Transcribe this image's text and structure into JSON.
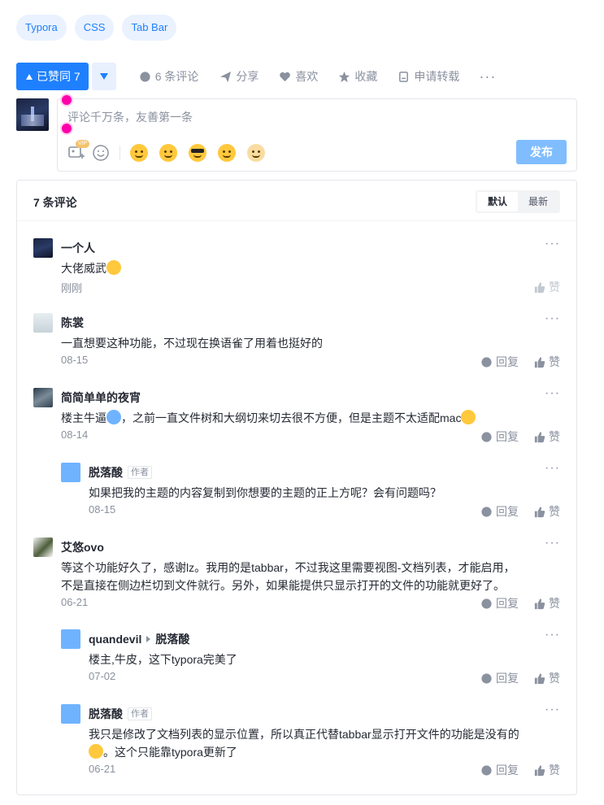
{
  "tags": [
    "Typora",
    "CSS",
    "Tab Bar"
  ],
  "actions": {
    "liked_label": "已赞同 7",
    "comment_label": "6 条评论",
    "share_label": "分享",
    "like_label": "喜欢",
    "favorite_label": "收藏",
    "repost_label": "申请转载",
    "more_label": "···"
  },
  "editor": {
    "placeholder": "评论千万条，友善第一条",
    "vip_badge": "VIP",
    "publish_label": "发布"
  },
  "comments_panel": {
    "title": "7 条评论",
    "sort_default": "默认",
    "sort_latest": "最新"
  },
  "comments": [
    {
      "name": "一个人",
      "text": "大佬威武",
      "time": "刚刚",
      "reply": "",
      "like": "赞"
    },
    {
      "name": "陈裳",
      "text": "一直想要这种功能，不过现在换语雀了用着也挺好的",
      "time": "08-15",
      "reply": "回复",
      "like": "赞"
    },
    {
      "name": "简简单单的夜宵",
      "text_a": "楼主牛逼",
      "text_b": "，之前一直文件树和大纲切来切去很不方便，但是主题不太适配mac",
      "time": "08-14",
      "reply": "回复",
      "like": "赞"
    },
    {
      "name": "脱落酸",
      "author_tag": "作者",
      "text": "如果把我的主题的内容复制到你想要的主题的正上方呢？会有问题吗？",
      "time": "08-15",
      "reply": "回复",
      "like": "赞"
    },
    {
      "name": "艾悠ovo",
      "text_l1": "等这个功能好久了，感谢lz。我用的是tabbar，不过我这里需要视图-文档列表，才能启用，",
      "text_l2": "不是直接在侧边栏切到文件就行。另外，如果能提供只显示打开的文件的功能就更好了。",
      "time": "06-21",
      "reply": "回复",
      "like": "赞"
    },
    {
      "name": "quandevil",
      "reply_to": "脱落酸",
      "text": "楼主,牛皮，这下typora完美了",
      "time": "07-02",
      "reply": "回复",
      "like": "赞"
    },
    {
      "name": "脱落酸",
      "author_tag": "作者",
      "text_l1": "我只是修改了文档列表的显示位置，所以真正代替tabbar显示打开文件的功能是没有的",
      "text_l2": "。这个只能靠typora更新了",
      "time": "06-21",
      "reply": "回复",
      "like": "赞"
    }
  ],
  "colors": {
    "brand": "#1e80ff",
    "muted": "#8a919f",
    "text": "#252933"
  }
}
